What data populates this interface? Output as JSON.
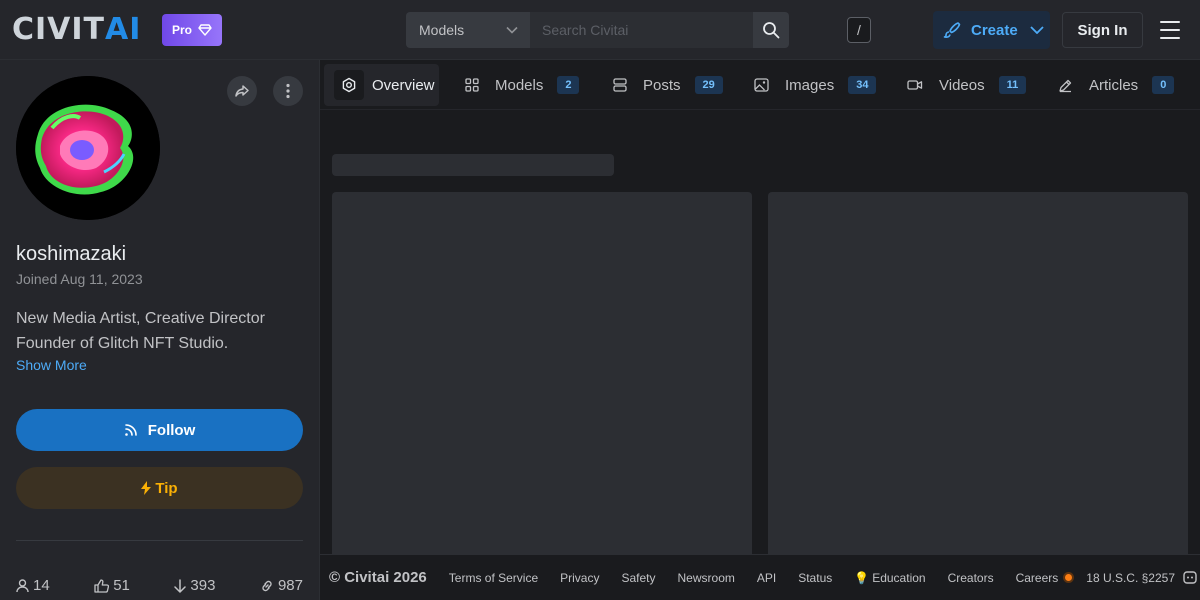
{
  "header": {
    "logo_left": "CIVIT",
    "logo_right": "AI",
    "pro_label": "Pro",
    "search_select": "Models",
    "search_placeholder": "Search Civitai",
    "shortcut_key": "/",
    "create_label": "Create",
    "signin_label": "Sign In"
  },
  "profile": {
    "username": "koshimazaki",
    "joined": "Joined Aug 11, 2023",
    "bio_line1": "New Media Artist, Creative Director",
    "bio_line2": "Founder of Glitch NFT Studio.",
    "show_more": "Show More",
    "follow_label": "Follow",
    "tip_label": "Tip",
    "stats": {
      "followers": "14",
      "likes": "51",
      "downloads": "393",
      "links": "987"
    }
  },
  "tabs": [
    {
      "label": "Overview",
      "count": null,
      "icon": "overview-icon",
      "active": true
    },
    {
      "label": "Models",
      "count": "2",
      "icon": "grid-icon"
    },
    {
      "label": "Posts",
      "count": "29",
      "icon": "posts-icon"
    },
    {
      "label": "Images",
      "count": "34",
      "icon": "image-icon"
    },
    {
      "label": "Videos",
      "count": "11",
      "icon": "video-icon"
    },
    {
      "label": "Articles",
      "count": "0",
      "icon": "pencil-icon"
    }
  ],
  "footer": {
    "copyright": "© Civitai 2026",
    "links": [
      "Terms of Service",
      "Privacy",
      "Safety",
      "Newsroom",
      "API",
      "Status",
      "Education",
      "Creators",
      "Careers",
      "18 U.S.C. §2257"
    ]
  },
  "colors": {
    "accent": "#228be6",
    "follow": "#1971c2",
    "tip": "#fab005",
    "pro": "#7950f2"
  }
}
